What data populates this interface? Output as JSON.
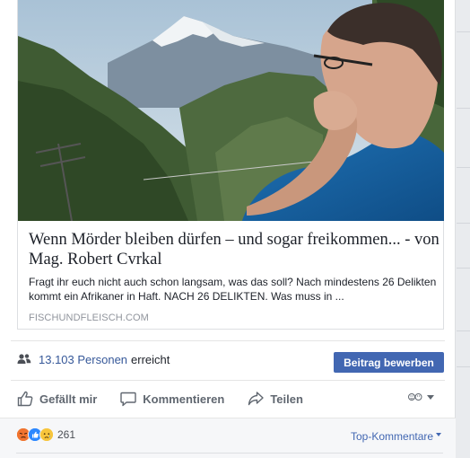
{
  "link": {
    "title": "Wenn Mörder bleiben dürfen – und sogar freikommen... - von Mag. Robert Cvrkal",
    "description": "Fragt ihr euch nicht auch schon langsam, was das soll? Nach mindestens 26 Delikten kommt ein Afrikaner in Haft. NACH 26 DELIKTEN. Was muss in ...",
    "domain": "FISCHUNDFLEISCH.COM",
    "image_subject": "man-looking-at-mountains"
  },
  "reach": {
    "icon": "people-icon",
    "count_text": "13.103 Personen",
    "suffix": "erreicht",
    "promote_label": "Beitrag bewerben"
  },
  "actions": {
    "like": {
      "label": "Gefällt mir",
      "icon": "thumbs-up-icon"
    },
    "comment": {
      "label": "Kommentieren",
      "icon": "speech-bubble-icon"
    },
    "share": {
      "label": "Teilen",
      "icon": "share-arrow-icon"
    }
  },
  "reactions": {
    "icons": [
      "angry-reaction-icon",
      "like-reaction-icon",
      "sad-reaction-icon"
    ],
    "count": "261",
    "sort_label": "Top-Kommentare"
  },
  "colors": {
    "link_blue": "#365899",
    "button_blue": "#4267b2",
    "muted": "#606770",
    "text": "#1d2129"
  }
}
